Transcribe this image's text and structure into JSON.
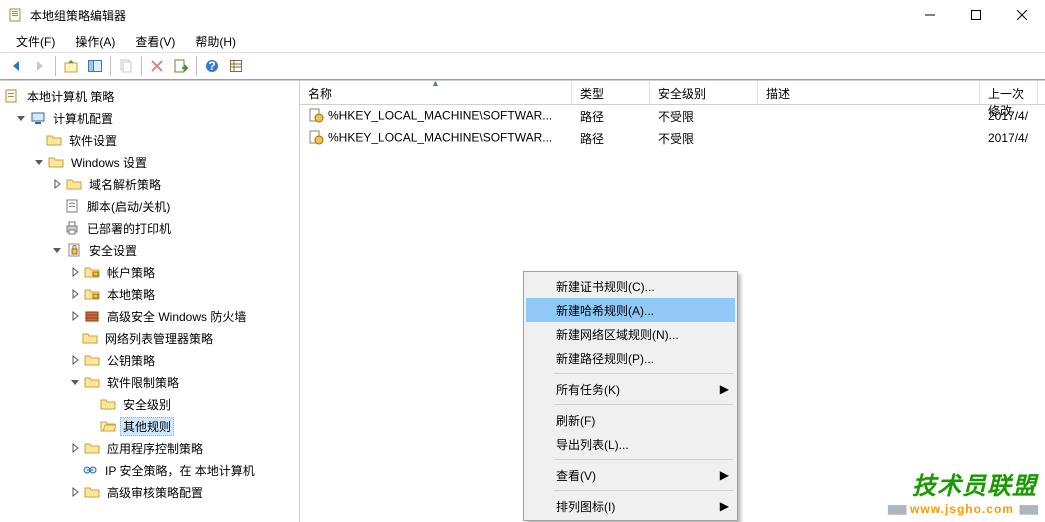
{
  "window": {
    "title": "本地组策略编辑器"
  },
  "menu": {
    "file": "文件(F)",
    "action": "操作(A)",
    "view": "查看(V)",
    "help": "帮助(H)"
  },
  "tree": {
    "root": "本地计算机 策略",
    "computer_config": "计算机配置",
    "software_settings": "软件设置",
    "windows_settings": "Windows 设置",
    "name_res_policy": "域名解析策略",
    "scripts": "脚本(启动/关机)",
    "deployed_printers": "已部署的打印机",
    "security_settings": "安全设置",
    "account_policy": "帐户策略",
    "local_policy": "本地策略",
    "adv_firewall": "高级安全 Windows 防火墙",
    "netlist_mgr": "网络列表管理器策略",
    "pubkey_policy": "公钥策略",
    "software_restrict": "软件限制策略",
    "security_levels": "安全级别",
    "other_rules": "其他规则",
    "appctrl_policy": "应用程序控制策略",
    "ipsec_policy": "IP 安全策略，在 本地计算机",
    "adv_audit": "高级审核策略配置"
  },
  "list": {
    "headers": {
      "name": "名称",
      "type": "类型",
      "security": "安全级别",
      "desc": "描述",
      "modified": "上一次修改"
    },
    "rows": [
      {
        "name": "%HKEY_LOCAL_MACHINE\\SOFTWAR...",
        "type": "路径",
        "security": "不受限",
        "desc": "",
        "modified": "2017/4/"
      },
      {
        "name": "%HKEY_LOCAL_MACHINE\\SOFTWAR...",
        "type": "路径",
        "security": "不受限",
        "desc": "",
        "modified": "2017/4/"
      }
    ]
  },
  "context_menu": {
    "new_cert_rule": "新建证书规则(C)...",
    "new_hash_rule": "新建哈希规则(A)...",
    "new_netzone_rule": "新建网络区域规则(N)...",
    "new_path_rule": "新建路径规则(P)...",
    "all_tasks": "所有任务(K)",
    "refresh": "刷新(F)",
    "export_list": "导出列表(L)...",
    "view": "查看(V)",
    "arrange_icons": "排列图标(I)"
  },
  "watermark": {
    "top": "技术员联盟",
    "bottom": "www.jsgho.com"
  }
}
